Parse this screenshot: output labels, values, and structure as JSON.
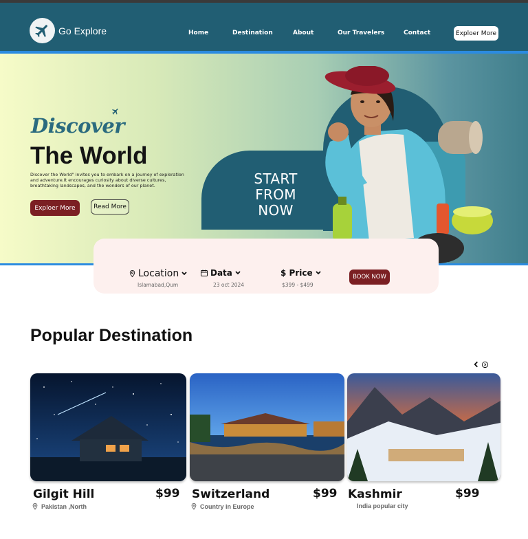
{
  "brand": {
    "name": "Go Explore",
    "icon": "airplane-icon"
  },
  "nav": {
    "links": [
      "Home",
      "Destination",
      "About",
      "Our Travelers",
      "Contact"
    ],
    "cta": "Exploer More"
  },
  "hero": {
    "script_title": "Discover",
    "title": "The World",
    "description": "Discover the World\" invites you to embark on a journey of exploration and adventure.It encourages curiosity about diverse cultures, breathtaking landscapes, and the wonders of our planet.",
    "primary_button": "Exploer More",
    "secondary_button": "Read More",
    "promo_lines": [
      "START",
      "FROM",
      "NOW"
    ]
  },
  "booking": {
    "location": {
      "label": "Location",
      "value": "Islamabad,Qum",
      "icon": "map-pin-icon"
    },
    "date": {
      "label": "Data",
      "value": "23 oct 2024",
      "icon": "calendar-icon"
    },
    "price": {
      "label": "$ Price",
      "value": "$399 - $499"
    },
    "button": "BOOK NOW"
  },
  "popular": {
    "title": "Popular Destination",
    "destinations": [
      {
        "name": "Gilgit Hill",
        "price": "$99",
        "location": "Pakistan ,North"
      },
      {
        "name": "Switzerland",
        "price": "$99",
        "location": "Country in Europe"
      },
      {
        "name": "Kashmir",
        "price": "$99",
        "location": "India popular city"
      }
    ]
  },
  "colors": {
    "primary": "#215e73",
    "accent": "#7b1f23",
    "rule": "#2b8be0",
    "card": "#fdf0ee"
  }
}
